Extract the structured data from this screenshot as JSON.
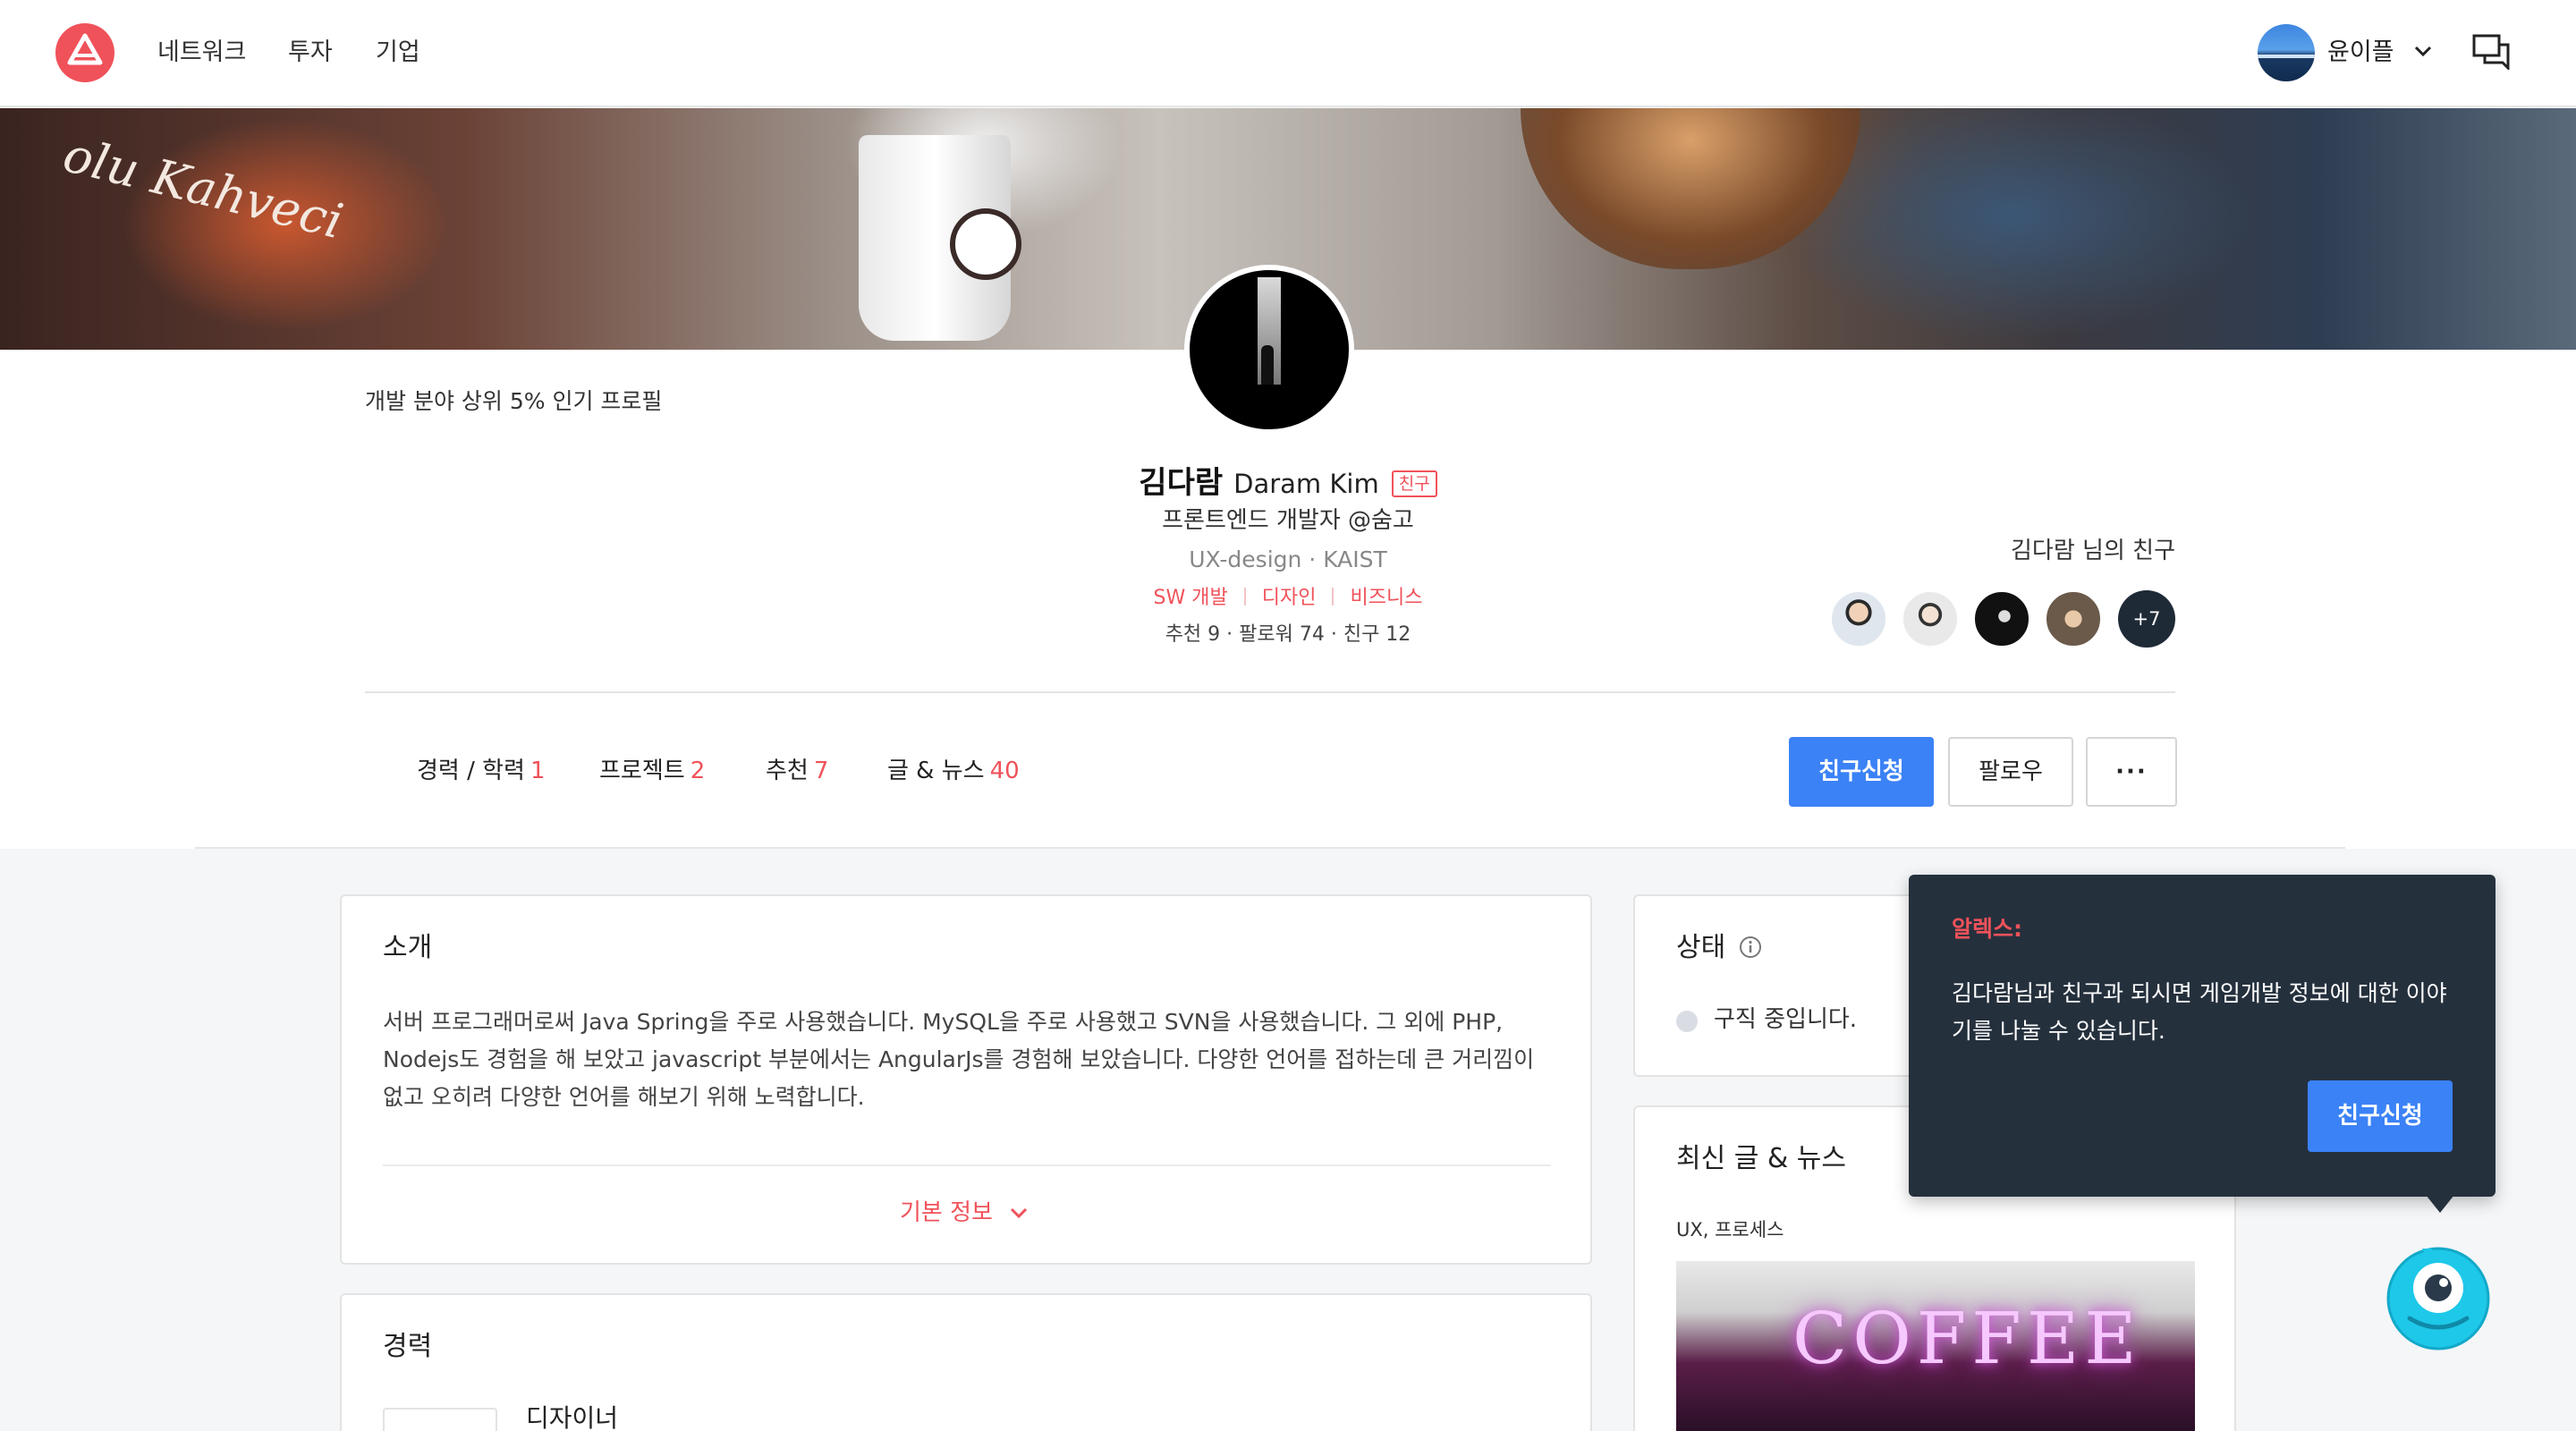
{
  "header": {
    "nav": [
      "네트워크",
      "투자",
      "기업"
    ],
    "user_name": "윤이플"
  },
  "cover": {
    "sign_text": "olu Kahveci"
  },
  "profile": {
    "popular_badge": "개발 분야 상위 5% 인기 프로필",
    "name_ko": "김다람",
    "name_en": "Daram Kim",
    "friend_badge": "친구",
    "headline": "프론트엔드 개발자 @숨고",
    "sub": "UX-design · KAIST",
    "tags": [
      "SW 개발",
      "디자인",
      "비즈니스"
    ],
    "stats": "추천 9 · 팔로워 74 · 친구 12"
  },
  "friends": {
    "title": "김다람 님의 친구",
    "more": "+7"
  },
  "tabs": [
    {
      "label": "경력 / 학력",
      "count": "1"
    },
    {
      "label": "프로젝트",
      "count": "2"
    },
    {
      "label": "추천",
      "count": "7"
    },
    {
      "label": "글 & 뉴스",
      "count": "40"
    }
  ],
  "actions": {
    "friend_request": "친구신청",
    "follow": "팔로우",
    "more": "···"
  },
  "intro": {
    "title": "소개",
    "text": "서버 프로그래머로써 Java Spring을 주로 사용했습니다. MySQL을 주로 사용했고 SVN을 사용했습니다. 그 외에 PHP, Nodejs도 경험을 해 보았고 javascript 부분에서는 AngularJs를 경험해 보았습니다. 다양한 언어를 접하는데 큰 거리낌이 없고 오히려 다양한 언어를 해보기 위해 노력합니다.",
    "basic_info": "기본 정보"
  },
  "career": {
    "title": "경력",
    "role": "디자이너"
  },
  "status": {
    "title": "상태",
    "text": "구직 중입니다."
  },
  "news": {
    "title": "최신 글 & 뉴스",
    "category": "UX, 프로세스",
    "image_text": "COFFEE"
  },
  "popover": {
    "title": "알렉스:",
    "text": "김다람님과 친구과 되시면 게임개발 정보에 대한 이야기를 나눌 수 있습니다.",
    "button": "친구신청"
  },
  "colors": {
    "accent": "#f0525a",
    "primary": "#3b82f6",
    "dark": "#25303d"
  }
}
